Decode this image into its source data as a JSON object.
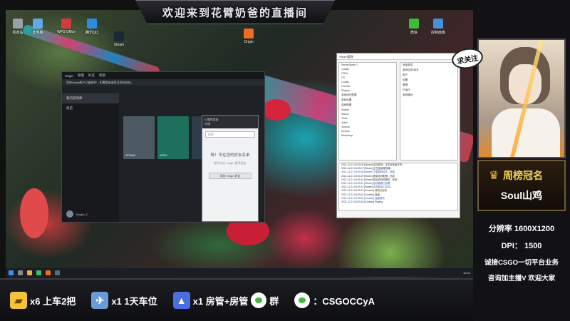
{
  "banner": {
    "title": "欢迎来到花臂奶爸的直播间"
  },
  "desktop": {
    "icons": [
      {
        "label": "此电脑",
        "color": "#5fa8e6"
      },
      {
        "label": "WPS Office",
        "color": "#d23b3b"
      },
      {
        "label": "腾讯QQ",
        "color": "#2d8ce0"
      },
      {
        "label": "回收站",
        "color": "#9aa0a8"
      },
      {
        "label": "微信",
        "color": "#3dbb3d"
      },
      {
        "label": "控制面板",
        "color": "#4a8fd6"
      },
      {
        "label": "Origin",
        "color": "#f26a21"
      },
      {
        "label": "Steam",
        "color": "#1b2838"
      }
    ]
  },
  "origin": {
    "menu": [
      "Origin",
      "管理",
      "好友",
      "帮助"
    ],
    "notice": "您的Origin帐户已被保护，如需登录请验证您的身份。",
    "nav": [
      "我的游戏库",
      "商店"
    ],
    "user": "Xiaoph_C",
    "games": [
      {
        "name": "STEAM",
        "color": "#4b5a63"
      },
      {
        "name": "APEX",
        "color": "#1e6f5c"
      },
      {
        "name": "",
        "color": "#2f3d4a"
      }
    ],
    "friends": {
      "header_1": "0 我的状态",
      "header_2": "在线",
      "search_placeholder": "搜索",
      "empty_title": "咦！不在您的好友名单",
      "empty_sub": "您可以在 Origin 搜寻好友",
      "add_button": "添加 Origin 好友"
    }
  },
  "tool": {
    "title": "Steam管理",
    "tree": [
      "ServerSprite 1",
      "Cookie",
      "CSGo",
      "CS",
      "Config",
      "Counter",
      "Plugins",
      "游戏运行配置",
      "游戏设置",
      "游戏配置",
      "Scripts",
      "Sound",
      "Tools",
      "Video",
      "Version",
      "Demos",
      "Workshop"
    ],
    "panel": [
      "添加新项",
      "游戏目录 版本",
      "帐户",
      "设置",
      "管理",
      "已运行",
      "游戏路径"
    ],
    "log": [
      {
        "text": "2021-11-21 04:03:06  [Steam] 启动游戏 - 正在检查版本号...",
        "blue": false
      },
      {
        "text": "2021-11-21 04:03:07  [Steam] 正在连接服务器...",
        "blue": false
      },
      {
        "text": "2021-11-21 04:03:08  [Steam] 下载游戏文件 - 完成",
        "blue": true
      },
      {
        "text": "2021-11-21 04:03:09  [Steam] 更新游戏配置 - 完成",
        "blue": false
      },
      {
        "text": "2021-11-21 04:03:10  [Steam] 验证游戏完整性 - 完成",
        "blue": false
      },
      {
        "text": "2021-11-21 04:03:11  [Steam] 启动参数已加载",
        "blue": true
      },
      {
        "text": "2021-11-21 04:03:12  [Steam] 正在启动 CSGO...",
        "blue": false
      },
      {
        "text": "2021-11-21 04:03:13  [Counter] 游戏已启动",
        "blue": false
      },
      {
        "text": "2021-11-21 04:03:14  [Counter] 就绪",
        "blue": false
      },
      {
        "text": "2021-11-21 04:03:15  [Counter] 连接成功",
        "blue": true
      },
      {
        "text": "2021-11-21 04:03:16  [Counter] Playing",
        "blue": false
      }
    ]
  },
  "taskbar": {
    "clock": "12:04"
  },
  "right_panel": {
    "follow": "求关注",
    "champion_title": "周榜冠名",
    "champion_name": "Soul山鸡",
    "resolution": "分辨率  1600X1200",
    "dpi": "DPI：  1500",
    "promo_1": "诚接CSGO一切平台业务",
    "promo_2": "咨询加主播V  欢迎大家"
  },
  "bottom_bar": {
    "rewards": [
      {
        "icon": "ticket-icon",
        "color": "#f3c13a",
        "glyph": "▰",
        "text": "x6  上车2把"
      },
      {
        "icon": "airplane-icon",
        "color": "#6c9ad8",
        "glyph": "✈",
        "text": "x1  1天车位"
      },
      {
        "icon": "rocket-icon",
        "color": "#4a6de0",
        "glyph": "🚀",
        "text": "x1  房管+房管"
      },
      {
        "icon": "wechat-icon",
        "color": "#3dbb3d",
        "glyph": "",
        "text": "群"
      },
      {
        "icon": "wechat-icon",
        "color": "#3dbb3d",
        "glyph": "",
        "text": "：CSGOCCyA"
      }
    ]
  }
}
